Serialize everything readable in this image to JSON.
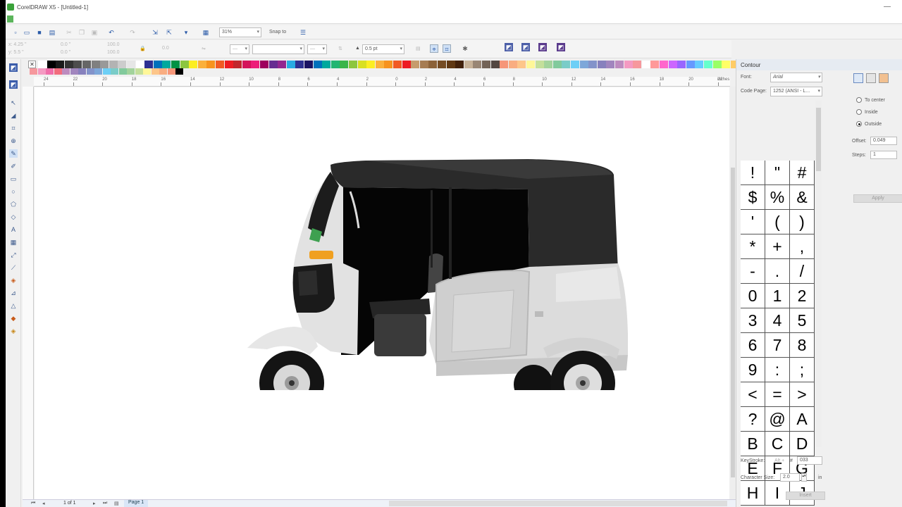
{
  "window": {
    "title": "CorelDRAW X5 - [Untitled-1]"
  },
  "toolbar": {
    "zoom": "31%",
    "snap_to": "Snap to",
    "outline_width": "0.5 pt"
  },
  "propbar": {
    "x": "x: 4.25 \"",
    "y": "y: 5.5 \"",
    "w": "0.0 \"",
    "h": "0.0 \"",
    "sx": "100.0",
    "sy": "100.0",
    "angle": "0.0"
  },
  "palette": {
    "colors": [
      "#ffffff",
      "#000000",
      "#1a1a1a",
      "#333333",
      "#4d4d4d",
      "#666666",
      "#808080",
      "#999999",
      "#b3b3b3",
      "#cccccc",
      "#e6e6e6",
      "#ffffff",
      "#2e3192",
      "#0071bc",
      "#00a99d",
      "#009245",
      "#8cc63f",
      "#fcee21",
      "#fbb03b",
      "#f7931e",
      "#f15a24",
      "#ed1c24",
      "#c1272d",
      "#d4145a",
      "#ed1e79",
      "#9e005d",
      "#662d91",
      "#93278f",
      "#29abe2",
      "#2e3192",
      "#1b1464",
      "#0071bc",
      "#00a99d",
      "#22b573",
      "#39b54a",
      "#8cc63f",
      "#d9e021",
      "#fcee21",
      "#fbb03b",
      "#f7931e",
      "#f15a24",
      "#ed1c24",
      "#c69c6d",
      "#a67c52",
      "#8c6239",
      "#754c24",
      "#603813",
      "#42210b",
      "#c7b299",
      "#998675",
      "#736357",
      "#534741",
      "#f69679",
      "#f9ad81",
      "#fdc68a",
      "#fff799",
      "#c4df9b",
      "#a3d39c",
      "#82ca9c",
      "#7accc8",
      "#6dcff6",
      "#7da7d9",
      "#8393ca",
      "#8781bd",
      "#a186be",
      "#bd8cbf",
      "#f49ac2",
      "#f6989d",
      "#ffffff",
      "#ff9999",
      "#ff66cc",
      "#cc66ff",
      "#9966ff",
      "#6699ff",
      "#66ccff",
      "#66ffcc",
      "#99ff66",
      "#ffff66",
      "#ffcc66",
      "#ff9966",
      "#ff6666",
      "#cc3366",
      "#993399",
      "#663399",
      "#336699",
      "#339999"
    ],
    "row2": [
      "#f6989d",
      "#f49ac2",
      "#f06eaa",
      "#f26d7d",
      "#bd8cbf",
      "#a186be",
      "#8781bd",
      "#8393ca",
      "#7da7d9",
      "#6dcff6",
      "#7accc8",
      "#82ca9c",
      "#a3d39c",
      "#c4df9b",
      "#fff799",
      "#fdc68a",
      "#f9ad81",
      "#f69679",
      "#000000"
    ]
  },
  "ruler": {
    "top_ticks": [
      "24",
      "22",
      "20",
      "18",
      "16",
      "14",
      "12",
      "10",
      "8",
      "6",
      "4",
      "2",
      "0",
      "2",
      "4",
      "6",
      "8",
      "10",
      "12",
      "14",
      "16",
      "18",
      "20",
      "22"
    ],
    "unit": "inches"
  },
  "status": {
    "page_count": "1 of 1",
    "page_tab": "Page 1"
  },
  "docker": {
    "title": "Contour",
    "font_label": "Font:",
    "font_value": "Arial",
    "code_page_label": "Code Page:",
    "code_page_value": "1252 (ANSI - L...",
    "glyphs": [
      "!",
      "\"",
      "#",
      "$",
      "%",
      "&",
      "'",
      "(",
      ")",
      "*",
      "+",
      ",",
      "-",
      ".",
      "/",
      "0",
      "1",
      "2",
      "3",
      "4",
      "5",
      "6",
      "7",
      "8",
      "9",
      ":",
      ";",
      "<",
      "=",
      ">",
      "?",
      "@",
      "A",
      "B",
      "C",
      "D",
      "E",
      "F",
      "G",
      "H",
      "I",
      "J"
    ],
    "keystroke_label": "KeyStroke:",
    "keystroke_alt": "Alt +",
    "keystroke_hash": "#",
    "keystroke_value": "033",
    "char_size_label": "Character Size:",
    "char_size_value": "2.0",
    "char_size_unit": "in",
    "insert_label": "Insert",
    "contour": {
      "to_center": "To center",
      "inside": "Inside",
      "outside": "Outside",
      "offset_label": "Offset:",
      "offset_value": "0.049",
      "steps_label": "Steps:",
      "steps_value": "1",
      "apply_label": "Apply"
    }
  }
}
